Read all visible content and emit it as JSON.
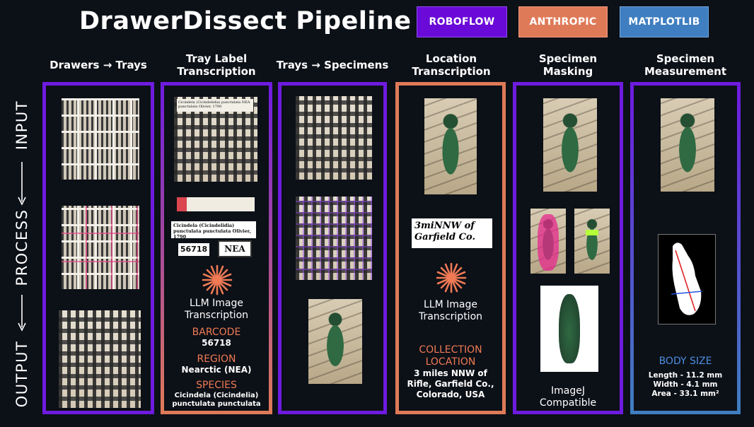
{
  "title": "DrawerDissect Pipeline",
  "badges": [
    "ROBOFLOW",
    "ANTHROPIC",
    "MATPLOTLIB"
  ],
  "side": {
    "input": "INPUT",
    "process": "PROCESS",
    "output": "OUTPUT"
  },
  "columns": [
    {
      "heading": "Drawers → Trays"
    },
    {
      "heading_line1": "Tray Label",
      "heading_line2": "Transcription"
    },
    {
      "heading": "Trays → Specimens"
    },
    {
      "heading_line1": "Location",
      "heading_line2": "Transcription"
    },
    {
      "heading_line1": "Specimen",
      "heading_line2": "Masking"
    },
    {
      "heading_line1": "Specimen",
      "heading_line2": "Measurement"
    }
  ],
  "label_card": {
    "line1": "Cicindela (Cicindelidia) punctulata",
    "line2": "punctulata Olivier, 1790",
    "barcode": "56718",
    "region_code": "NEA",
    "tag": "NEA"
  },
  "location_snippet": "3miNNW of Garfield Co.",
  "llm_label": {
    "line1": "LLM Image",
    "line2": "Transcription"
  },
  "col2_output": {
    "barcode_title": "BARCODE",
    "barcode_value": "56718",
    "region_title": "REGION",
    "region_value": "Nearctic (NEA)",
    "species_title": "SPECIES",
    "species_line1": "Cicindela (Cicindelia)",
    "species_line2": "punctulata punctulata"
  },
  "col4_output": {
    "title_line1": "COLLECTION",
    "title_line2": "LOCATION",
    "line1": "3 miles NNW of",
    "line2": "Rifle, Garfield Co.,",
    "line3": "Colorado, USA"
  },
  "col5_output": {
    "line1": "ImageJ",
    "line2": "Compatible"
  },
  "col6_output": {
    "title": "BODY SIZE",
    "length": "Length - 11.2 mm",
    "width": "Width - 4.1 mm",
    "area": "Area - 33.1 mm²"
  },
  "colors": {
    "roboflow": "#6a0ad8",
    "anthropic": "#df7a58",
    "matplotlib": "#3f7ec0",
    "background": "#0c1017"
  }
}
